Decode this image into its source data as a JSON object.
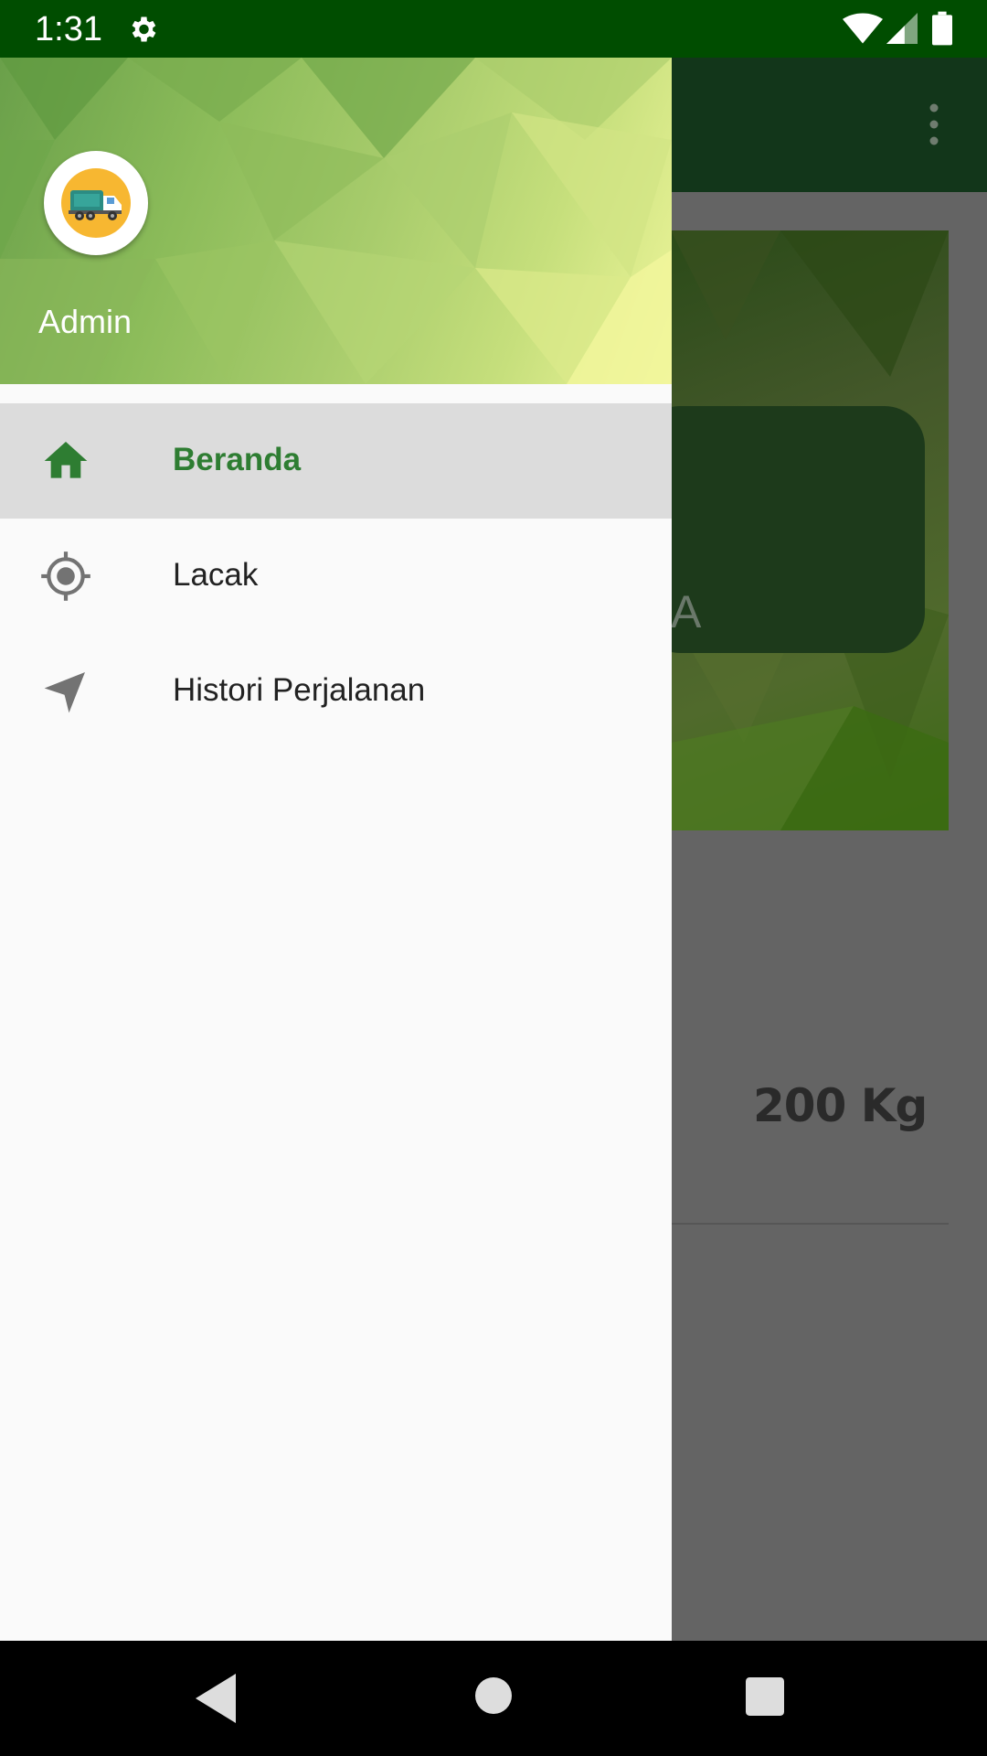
{
  "status_bar": {
    "time": "1:31",
    "icons": [
      "gear-icon",
      "wifi-icon",
      "cell-signal-icon",
      "battery-icon"
    ]
  },
  "background_app": {
    "toolbar_menu_icon": "overflow-menu-icon",
    "banner_partial_text": "A",
    "weight_value": "200 Kg"
  },
  "drawer": {
    "header": {
      "avatar_icon": "garbage-truck-icon",
      "user_name": "Admin"
    },
    "menu": [
      {
        "label": "Beranda",
        "icon": "home-icon",
        "selected": true
      },
      {
        "label": "Lacak",
        "icon": "gps-target-icon",
        "selected": false
      },
      {
        "label": "Histori Perjalanan",
        "icon": "navigation-arrow-icon",
        "selected": false
      }
    ]
  },
  "nav_bar": {
    "icons": [
      "back-icon",
      "home-circle-icon",
      "recents-icon"
    ]
  },
  "colors": {
    "status_bar": "#004d00",
    "accent": "#2e7d32",
    "drawer_bg": "#fafafa",
    "selected_item_bg": "#dcdcdc"
  }
}
